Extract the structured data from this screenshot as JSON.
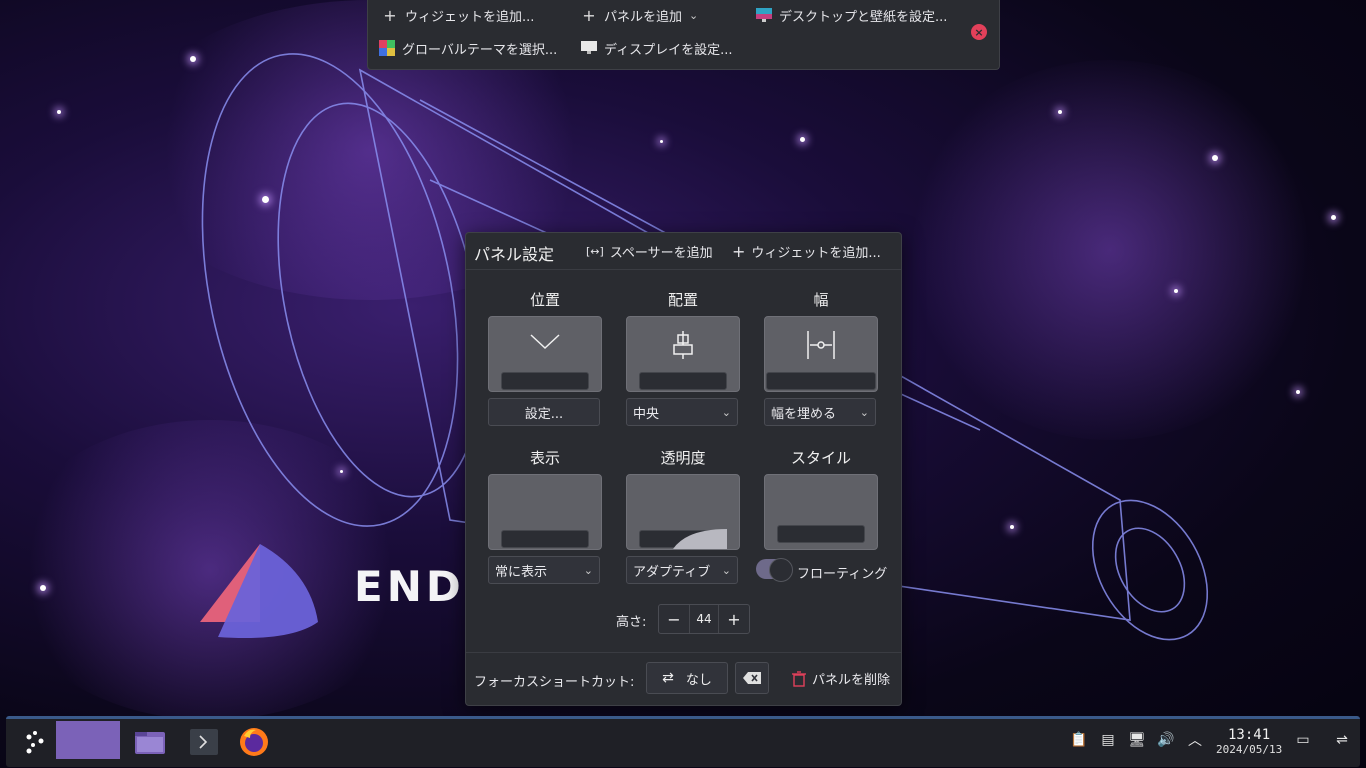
{
  "topbar": {
    "add_widget": "ウィジェットを追加...",
    "add_panel": "パネルを追加",
    "desktop_wallpaper": "デスクトップと壁紙を設定...",
    "global_theme": "グローバルテーマを選択...",
    "display_settings": "ディスプレイを設定..."
  },
  "wallpaper": {
    "brand_text": "ENDEA"
  },
  "panel_settings": {
    "title": "パネル設定",
    "add_spacer": "スペーサーを追加",
    "add_widget": "ウィジェットを追加...",
    "position": {
      "label": "位置",
      "button": "設定..."
    },
    "alignment": {
      "label": "配置",
      "value": "中央"
    },
    "width": {
      "label": "幅",
      "value": "幅を埋める"
    },
    "visibility": {
      "label": "表示",
      "value": "常に表示"
    },
    "opacity": {
      "label": "透明度",
      "value": "アダプティブ"
    },
    "style": {
      "label": "スタイル",
      "toggle_label": "フローティング",
      "floating": true
    },
    "height": {
      "label": "高さ:",
      "value": "44"
    },
    "footer": {
      "focus_shortcut_label": "フォーカスショートカット:",
      "shortcut_value": "なし",
      "delete_panel": "パネルを削除"
    }
  },
  "taskbar": {
    "clock_time": "13:41",
    "clock_date": "2024/05/13",
    "colors": {
      "accent": "#7b62b8",
      "panel_bg": "#1f2026",
      "border": "#3a5a8a"
    }
  }
}
